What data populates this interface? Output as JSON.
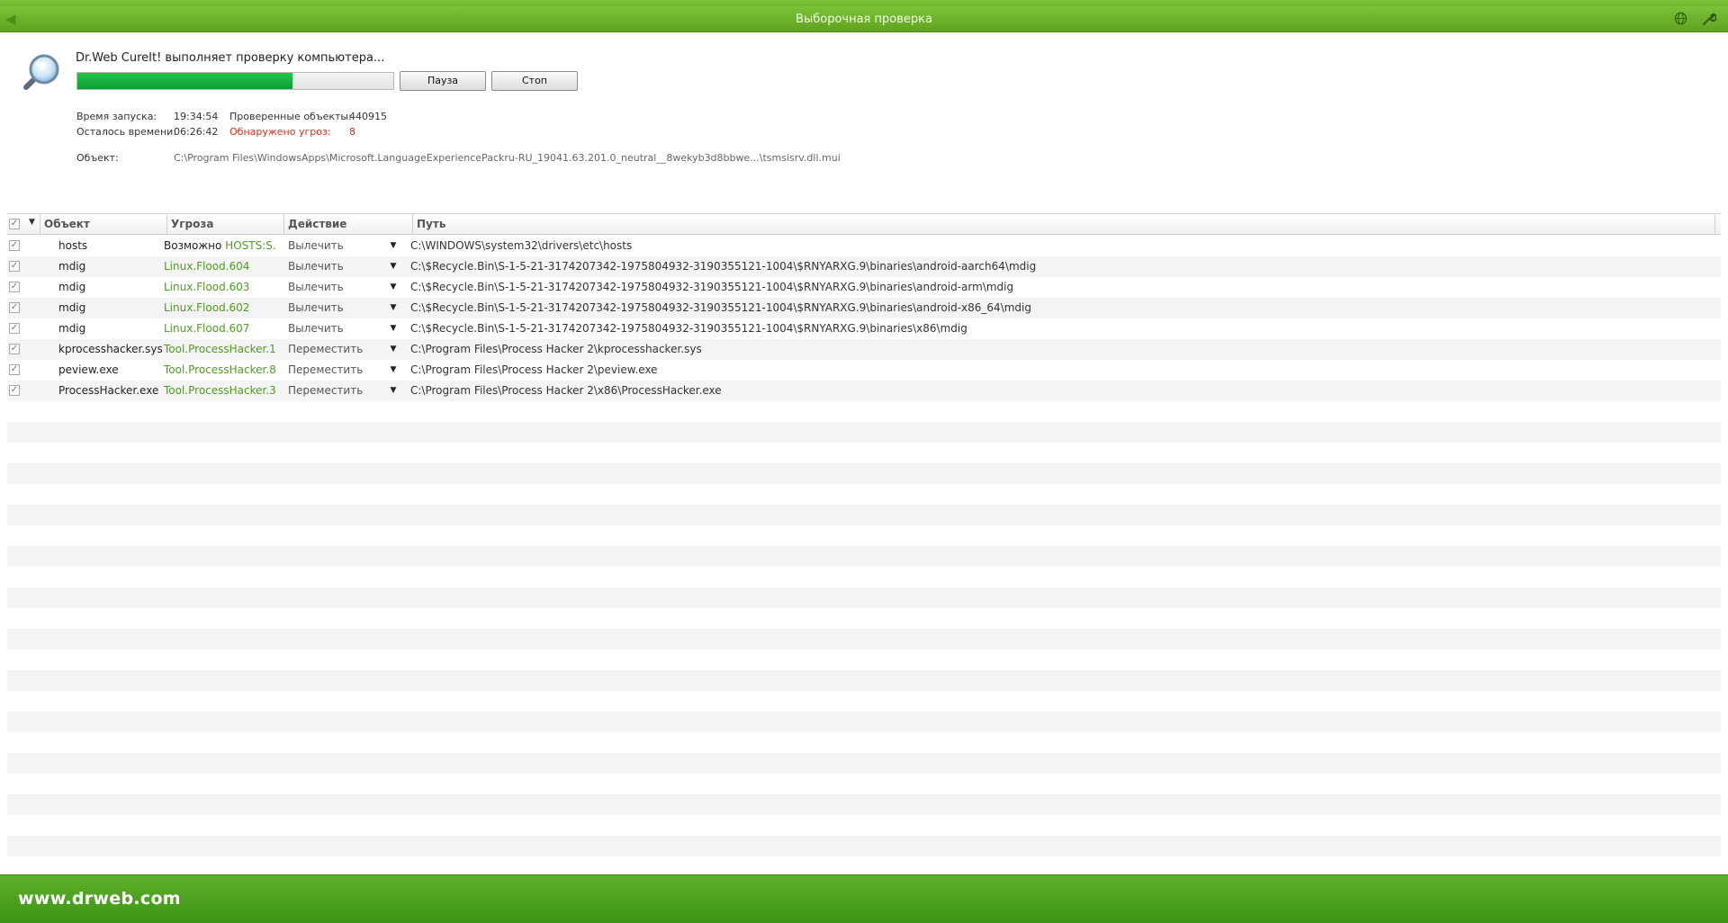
{
  "window": {
    "title": "Выборочная проверка"
  },
  "scan": {
    "status": "Dr.Web CureIt! выполняет проверку компьютера...",
    "progress_fraction": 0.68,
    "pause_label": "Пауза",
    "stop_label": "Стоп",
    "start_time_label": "Время запуска:",
    "start_time_value": "19:34:54",
    "remaining_label": "Осталось времени:",
    "remaining_value": "06:26:42",
    "checked_label": "Проверенные объекты:",
    "checked_value": "440915",
    "threats_label": "Обнаружено угроз:",
    "threats_value": "8",
    "object_label": "Объект:",
    "object_value": "C:\\Program Files\\WindowsApps\\Microsoft.LanguageExperiencePackru-RU_19041.63.201.0_neutral__8wekyb3d8bbwe...\\tsmsisrv.dll.mui"
  },
  "table": {
    "headers": {
      "object": "Объект",
      "threat": "Угроза",
      "action": "Действие",
      "path": "Путь"
    },
    "rows": [
      {
        "object": "hosts",
        "threat_prefix": "Возможно ",
        "threat": "HOSTS:S...",
        "action": "Вылечить",
        "path": "C:\\WINDOWS\\system32\\drivers\\etc\\hosts"
      },
      {
        "object": "mdig",
        "threat_prefix": "",
        "threat": "Linux.Flood.604",
        "action": "Вылечить",
        "path": "C:\\$Recycle.Bin\\S-1-5-21-3174207342-1975804932-3190355121-1004\\$RNYARXG.9\\binaries\\android-aarch64\\mdig"
      },
      {
        "object": "mdig",
        "threat_prefix": "",
        "threat": "Linux.Flood.603",
        "action": "Вылечить",
        "path": "C:\\$Recycle.Bin\\S-1-5-21-3174207342-1975804932-3190355121-1004\\$RNYARXG.9\\binaries\\android-arm\\mdig"
      },
      {
        "object": "mdig",
        "threat_prefix": "",
        "threat": "Linux.Flood.602",
        "action": "Вылечить",
        "path": "C:\\$Recycle.Bin\\S-1-5-21-3174207342-1975804932-3190355121-1004\\$RNYARXG.9\\binaries\\android-x86_64\\mdig"
      },
      {
        "object": "mdig",
        "threat_prefix": "",
        "threat": "Linux.Flood.607",
        "action": "Вылечить",
        "path": "C:\\$Recycle.Bin\\S-1-5-21-3174207342-1975804932-3190355121-1004\\$RNYARXG.9\\binaries\\x86\\mdig"
      },
      {
        "object": "kprocesshacker.sys",
        "threat_prefix": "",
        "threat": "Tool.ProcessHacker.1",
        "action": "Переместить",
        "path": "C:\\Program Files\\Process Hacker 2\\kprocesshacker.sys"
      },
      {
        "object": "peview.exe",
        "threat_prefix": "",
        "threat": "Tool.ProcessHacker.8",
        "action": "Переместить",
        "path": "C:\\Program Files\\Process Hacker 2\\peview.exe"
      },
      {
        "object": "ProcessHacker.exe",
        "threat_prefix": "",
        "threat": "Tool.ProcessHacker.3",
        "action": "Переместить",
        "path": "C:\\Program Files\\Process Hacker 2\\x86\\ProcessHacker.exe"
      }
    ]
  },
  "footer": {
    "brand": "www.drweb.com"
  },
  "colors": {
    "brand_green": "#5db02a",
    "progress_green": "#14b03e",
    "threat_green": "#4d9d1e",
    "alert_red": "#d0331c"
  },
  "icons": [
    "back-arrow-icon",
    "globe-icon",
    "wrench-icon",
    "magnifier-icon",
    "checkbox-icon",
    "dropdown-arrow-icon"
  ]
}
